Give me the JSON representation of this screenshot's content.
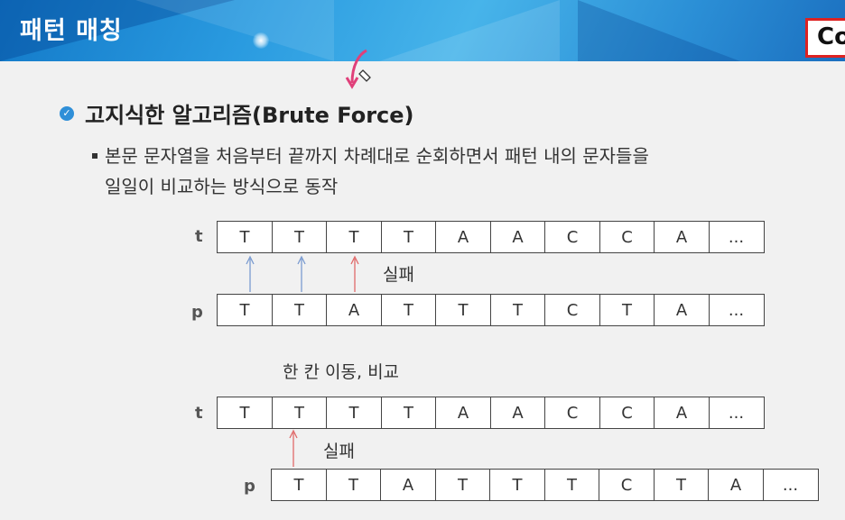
{
  "header": {
    "title": "패턴 매칭",
    "corner_text": "Co"
  },
  "heading": "고지식한 알고리즘(Brute Force)",
  "description": [
    "본문 문자열을 처음부터 끝까지 차례대로 순회하면서 패턴 내의 문자들을",
    "일일이 비교하는 방식으로 동작"
  ],
  "step1": {
    "t_label": "t",
    "t": [
      "T",
      "T",
      "T",
      "T",
      "A",
      "A",
      "C",
      "C",
      "A",
      "..."
    ],
    "p_label": "p",
    "p": [
      "T",
      "T",
      "A",
      "T",
      "T",
      "T",
      "C",
      "T",
      "A",
      "..."
    ],
    "fail_label": "실패"
  },
  "shift_label": "한 칸 이동, 비교",
  "step2": {
    "t_label": "t",
    "t": [
      "T",
      "T",
      "T",
      "T",
      "A",
      "A",
      "C",
      "C",
      "A",
      "..."
    ],
    "p_label": "p",
    "p": [
      "T",
      "T",
      "A",
      "T",
      "T",
      "T",
      "C",
      "T",
      "A",
      "..."
    ],
    "fail_label": "실패"
  },
  "colors": {
    "match_arrow": "#7a9bd0",
    "fail_arrow": "#e06a6a",
    "accent": "#2f8fd8",
    "cursor": "#e0407a"
  }
}
